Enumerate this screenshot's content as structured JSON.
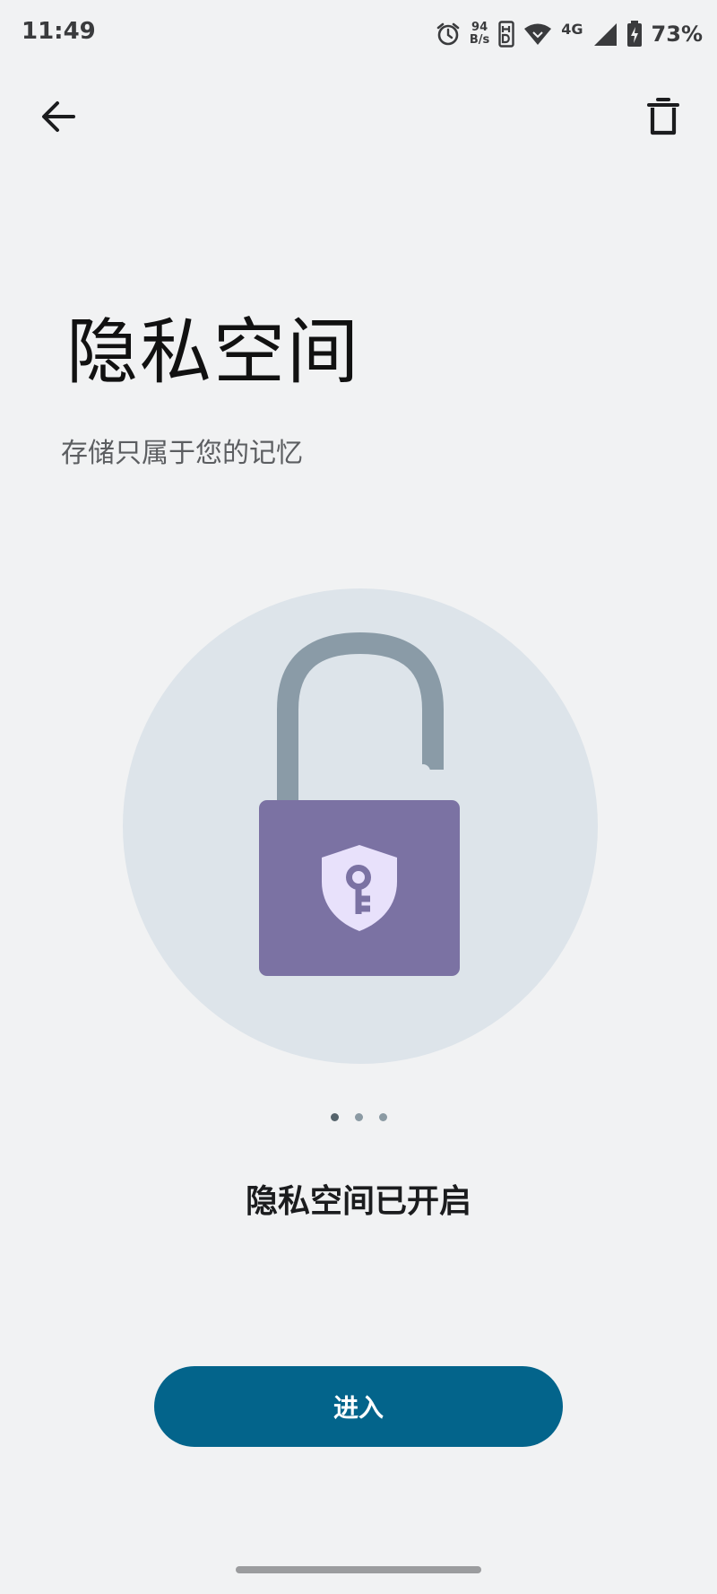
{
  "status_bar": {
    "time": "11:49",
    "net_speed_value": "94",
    "net_speed_unit": "B/s",
    "network_type": "4G",
    "battery": "73%",
    "icons": [
      "alarm-icon",
      "volte-icon",
      "wifi-icon",
      "signal-icon",
      "battery-charging-icon"
    ]
  },
  "header": {
    "back_icon": "arrow-left-icon",
    "delete_icon": "trash-icon"
  },
  "main": {
    "title": "隐私空间",
    "subtitle": "存储只属于您的记忆",
    "illustration": "padlock-shield-key",
    "page_indicator": {
      "count": 3,
      "active": 0
    },
    "status": "隐私空间已开启",
    "enter_label": "进入"
  },
  "colors": {
    "background": "#f1f2f3",
    "circle": "#dde4ea",
    "lock_body": "#7b72a3",
    "shackle": "#8a9ba7",
    "shield": "#e8e1fb",
    "button": "#03648b"
  }
}
